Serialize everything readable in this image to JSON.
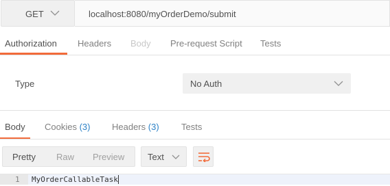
{
  "request": {
    "method": "GET",
    "url": "localhost:8080/myOrderDemo/submit"
  },
  "request_tabs": [
    {
      "label": "Authorization",
      "state": "active"
    },
    {
      "label": "Headers",
      "state": "normal"
    },
    {
      "label": "Body",
      "state": "disabled"
    },
    {
      "label": "Pre-request Script",
      "state": "normal"
    },
    {
      "label": "Tests",
      "state": "normal"
    }
  ],
  "auth": {
    "type_label": "Type",
    "type_value": "No Auth"
  },
  "response_tabs": [
    {
      "label": "Body",
      "count": "",
      "state": "active"
    },
    {
      "label": "Cookies",
      "count": "(3)",
      "state": "normal"
    },
    {
      "label": "Headers",
      "count": "(3)",
      "state": "normal"
    },
    {
      "label": "Tests",
      "count": "",
      "state": "normal"
    }
  ],
  "response_toolbar": {
    "views": [
      "Pretty",
      "Raw",
      "Preview"
    ],
    "active_view": "Pretty",
    "format": "Text"
  },
  "response_body": {
    "lines": [
      {
        "number": "1",
        "text": "MyOrderCallableTask"
      }
    ]
  },
  "colors": {
    "accent": "#f26b3a",
    "count": "#2d82c7",
    "bar_bg": "#f0f0f0"
  }
}
